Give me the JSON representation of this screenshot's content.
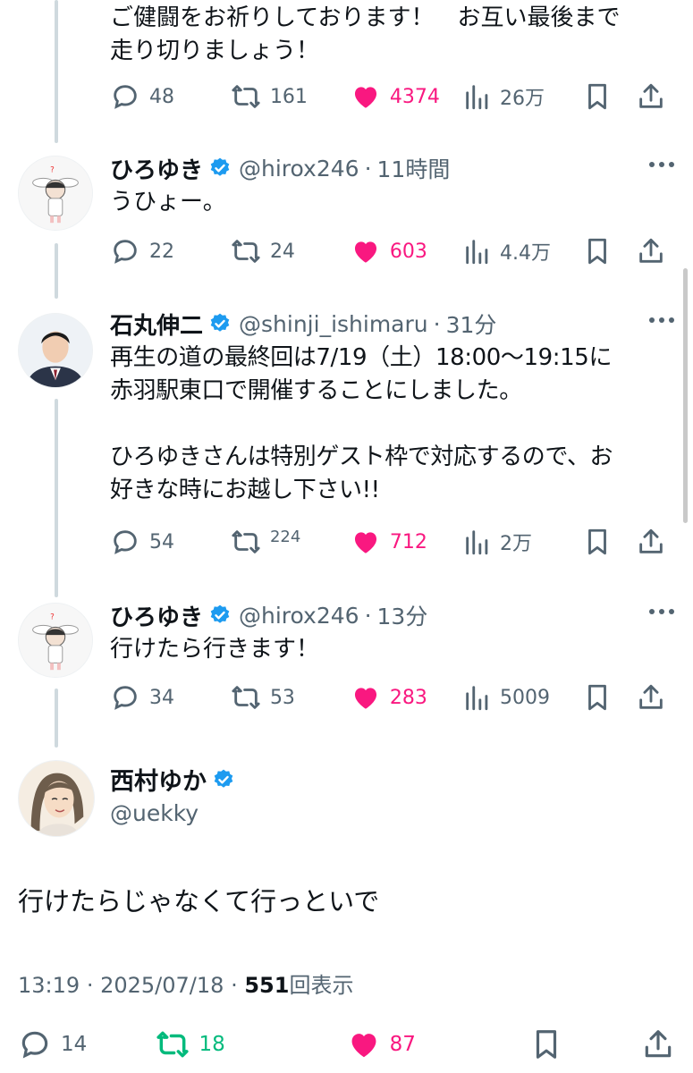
{
  "colors": {
    "accent": "#1d9bf0",
    "like": "#f91880",
    "retweet_active": "#00ba7c",
    "secondary": "#536471",
    "thread_line": "#cfd9de"
  },
  "top_fragment": {
    "text": "ご健闘をお祈りしております！　お互い最後まで\n走り切りましょう！",
    "reply": "48",
    "retweet": "161",
    "like": "4374",
    "views": "26万"
  },
  "replies": [
    {
      "name": "ひろゆき",
      "handle": "@hirox246",
      "time": "11時間",
      "text": "うひょー。",
      "reply": "22",
      "retweet": "24",
      "like": "603",
      "views": "4.4万"
    },
    {
      "name": "石丸伸二",
      "handle": "@shinji_ishimaru",
      "time": "31分",
      "text": "再生の道の最終回は7/19（土）18:00〜19:15に\n赤羽駅東口で開催することにしました。\n\nひろゆきさんは特別ゲスト枠で対応するので、お\n好きな時にお越し下さい!!",
      "reply": "54",
      "retweet": "224",
      "like": "712",
      "views": "2万"
    },
    {
      "name": "ひろゆき",
      "handle": "@hirox246",
      "time": "13分",
      "text": "行けたら行きます！",
      "reply": "34",
      "retweet": "53",
      "like": "283",
      "views": "5009"
    }
  ],
  "main_tweet": {
    "name": "西村ゆか",
    "handle": "@uekky",
    "text": "行けたらじゃなくて行っといで",
    "time": "13:19",
    "date": "2025/07/18",
    "views_count": "551",
    "views_label": "回表示",
    "reply": "14",
    "retweet": "18",
    "like": "87"
  },
  "separator": "·"
}
